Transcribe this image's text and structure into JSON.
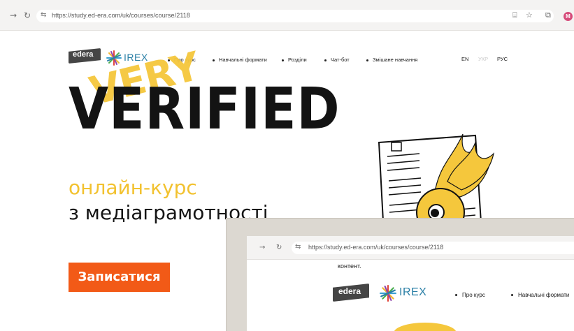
{
  "browser": {
    "url": "https://study.ed-era.com/uk/courses/course/2118",
    "profile_initial": "M"
  },
  "site": {
    "logo_edera": "edera",
    "logo_irex": "IREX",
    "nav": [
      "Про курс",
      "Навчальні формати",
      "Розділи",
      "Чат-бот",
      "Змішане навчання"
    ],
    "languages": [
      "EN",
      "УКР",
      "РУС"
    ],
    "active_language": "УКР"
  },
  "hero": {
    "overlay_word": "VERY",
    "title": "VERIFIED",
    "subtitle_line1": "онлайн-курс",
    "subtitle_line2": "з медіаграмотності",
    "cta_label": "Записатися"
  },
  "second_window": {
    "url": "https://study.ed-era.com/uk/courses/course/2118",
    "content_word": "контент.",
    "logo_edera": "edera",
    "logo_irex": "IREX",
    "nav": [
      "Про курс",
      "Навчальні формати"
    ]
  },
  "colors": {
    "accent_orange": "#f25a17",
    "accent_yellow": "#f5c73c",
    "irex_blue": "#2a7fa6"
  }
}
